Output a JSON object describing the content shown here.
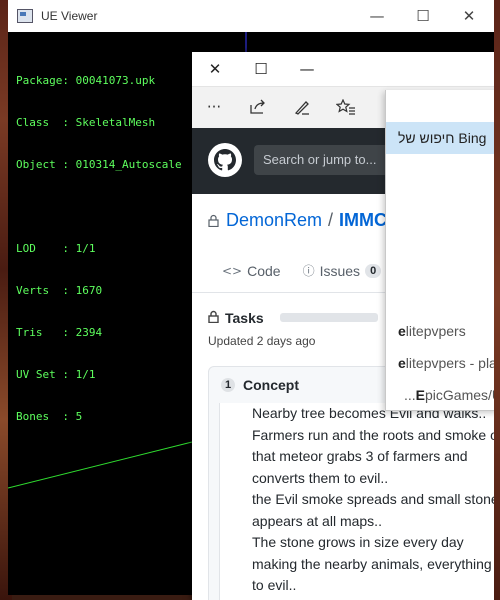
{
  "uev": {
    "title": "UE Viewer",
    "info": {
      "package": "Package: 00041073.upk",
      "class": "Class  : SkeletalMesh",
      "object": "Object : 010314_Autoscale",
      "lod": "LOD    : 1/1",
      "verts": "Verts  : 1670",
      "tris": "Tris   : 2394",
      "uvset": "UV Set : 1/1",
      "bones": "Bones  : 5"
    },
    "colors": {
      "text": "#5eff5e",
      "background": "#000000"
    }
  },
  "browser": {
    "toolbar": {
      "more": "···",
      "share": "share-icon",
      "notes": "pen-icon",
      "favorites": "favorites-icon"
    },
    "search_placeholder": "Search or jump to...",
    "repo": {
      "owner": "DemonRem",
      "separator": "/",
      "name": "IMMC"
    },
    "tabs": [
      {
        "label": "Code"
      },
      {
        "label": "Issues",
        "count": "0"
      }
    ],
    "project": {
      "title": "Tasks",
      "updated": "Updated 2 days ago"
    },
    "column": {
      "count": "1",
      "title": "Concept"
    },
    "card_lines": [
      "Nearby tree becomes Evil and walks..",
      "Farmers run and the roots and smoke of",
      "that meteor grabs 3 of farmers and",
      "converts them to evil..",
      "the Evil smoke spreads and small stone",
      "appears at all maps..",
      "The stone grows in size every day",
      "making the nearby animals, everything",
      "to evil.."
    ],
    "colors": {
      "header": "#24292e",
      "link": "#0366d6"
    }
  },
  "dropdown": {
    "bing": "חיפוש של Bing",
    "s1_bold": "e",
    "s1_rest": "litepvpers",
    "s2_bold": "e",
    "s2_rest": "litepvpers - pla",
    "s3_prefix": "...",
    "s3_bold": "E",
    "s3_rest": "picGames/U",
    "highlight": "#cce4f7"
  }
}
